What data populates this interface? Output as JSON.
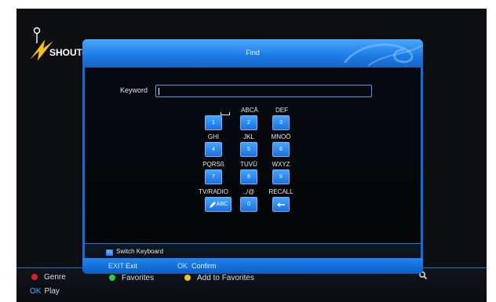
{
  "app": {
    "logo_text": "SHOUTc"
  },
  "bottom_bar": {
    "genre": {
      "label": "Genre",
      "color": "#e02020"
    },
    "play": {
      "key": "OK",
      "label": "Play"
    },
    "favorites": {
      "label": "Favorites",
      "color": "#2ecc40"
    },
    "add_favorites": {
      "label": "Add to Favorites",
      "color": "#f2c21b"
    },
    "search_icon": "magnifier-icon"
  },
  "dialog": {
    "title": "Find",
    "keyword_label": "Keyword",
    "keyword_value": "",
    "keys": [
      {
        "label": "",
        "label_icon": "space-bar-icon",
        "key": "1"
      },
      {
        "label": "ABCÄ",
        "key": "2"
      },
      {
        "label": "DEF",
        "key": "3"
      },
      {
        "label": "GHI",
        "key": "4"
      },
      {
        "label": "JKL",
        "key": "5"
      },
      {
        "label": "MNOÖ",
        "key": "6"
      },
      {
        "label": "PQRSß",
        "key": "7"
      },
      {
        "label": "TUVÜ",
        "key": "8"
      },
      {
        "label": "WXYZ",
        "key": "9"
      },
      {
        "label": "TV/RADIO",
        "key": "ABC",
        "key_icon": "pencil-icon"
      },
      {
        "label": ".,/@",
        "key": "0"
      },
      {
        "label": "RECALL",
        "key": "←",
        "key_icon": "back-arrow-icon"
      }
    ],
    "switch_keyboard": {
      "badge": "F1",
      "label": "Switch Keyboard"
    },
    "footer": {
      "exit": {
        "key": "EXIT",
        "label": "Exit"
      },
      "confirm": {
        "key": "OK",
        "label": "Confirm"
      }
    }
  },
  "colors": {
    "accent": "#1a72dd",
    "highlight": "#44a4ff"
  }
}
